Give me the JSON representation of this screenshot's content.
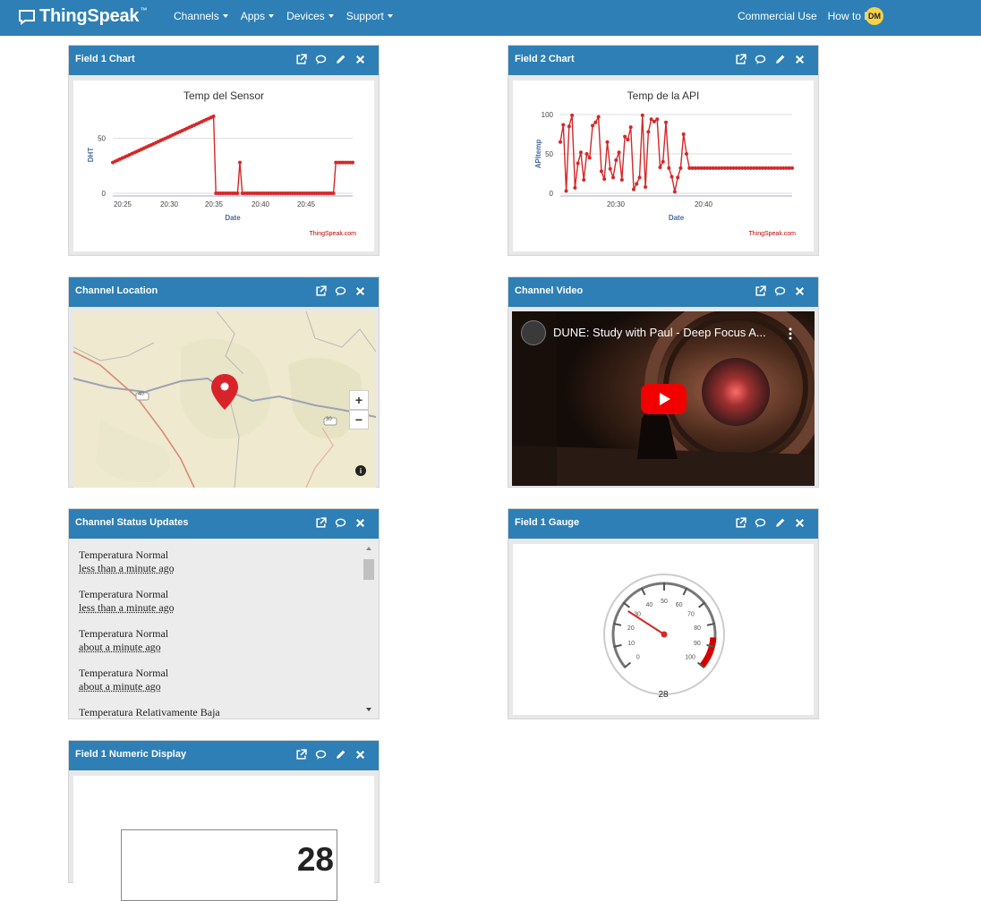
{
  "navbar": {
    "brand": "ThingSpeak",
    "tm": "™",
    "menu": [
      "Channels",
      "Apps",
      "Devices",
      "Support"
    ],
    "commercial_use": "Commercial Use",
    "how_to_buy": "How to Buy",
    "avatar_initials": "DM"
  },
  "widgets": {
    "field1_chart": {
      "title": "Field 1 Chart",
      "chart_title": "Temp del Sensor",
      "watermark": "ThingSpeak.com",
      "chart_data": {
        "type": "line",
        "title": "Temp del Sensor",
        "xlabel": "Date",
        "ylabel": "DHT",
        "x_ticks": [
          "20:25",
          "20:30",
          "20:35",
          "20:40",
          "20:45"
        ],
        "y_ticks": [
          "0",
          "50"
        ],
        "ylim": [
          0,
          70
        ],
        "color": "#d62728",
        "series": [
          {
            "x": [
              0,
              1,
              2,
              3,
              4,
              5,
              6,
              7,
              8,
              9,
              10,
              11,
              12,
              13,
              14,
              15,
              16,
              17,
              18,
              19,
              20,
              21,
              22,
              23,
              24,
              25,
              26,
              27,
              28,
              29,
              30,
              31,
              32,
              33,
              34,
              35,
              36,
              37,
              38,
              39,
              40,
              41,
              42,
              43,
              44,
              45,
              46,
              47,
              48,
              49,
              50,
              51,
              52,
              53,
              54,
              55,
              56,
              57,
              58,
              59,
              60,
              61,
              62,
              63,
              64,
              65,
              66,
              67,
              68,
              69,
              70,
              71,
              72,
              73,
              74,
              75,
              76,
              77,
              78,
              79,
              80,
              81,
              82,
              83,
              84,
              85,
              86,
              87,
              88,
              89,
              90,
              91,
              92,
              93,
              94,
              95,
              96,
              97,
              98,
              99,
              100
            ],
            "y": [
              28,
              29,
              30,
              31,
              32,
              33,
              34,
              35,
              36,
              37,
              38,
              39,
              40,
              41,
              42,
              43,
              44,
              45,
              46,
              47,
              48,
              49,
              50,
              51,
              52,
              53,
              54,
              55,
              56,
              57,
              58,
              59,
              60,
              61,
              62,
              63,
              64,
              65,
              66,
              67,
              68,
              69,
              70,
              0,
              0,
              0,
              0,
              0,
              0,
              0,
              0,
              0,
              0,
              28,
              0,
              0,
              0,
              0,
              0,
              0,
              0,
              0,
              0,
              0,
              0,
              0,
              0,
              0,
              0,
              0,
              0,
              0,
              0,
              0,
              0,
              0,
              0,
              0,
              0,
              0,
              0,
              0,
              0,
              0,
              0,
              0,
              0,
              0,
              0,
              0,
              0,
              0,
              0,
              28,
              28,
              28,
              28,
              28,
              28,
              28,
              28
            ]
          }
        ]
      }
    },
    "field2_chart": {
      "title": "Field 2 Chart",
      "chart_title": "Temp de la API",
      "watermark": "ThingSpeak.com",
      "chart_data": {
        "type": "line",
        "title": "Temp de la API",
        "xlabel": "Date",
        "ylabel": "APItemp",
        "x_ticks": [
          "20:30",
          "20:40"
        ],
        "y_ticks": [
          "0",
          "50",
          "100"
        ],
        "ylim": [
          0,
          100
        ],
        "color": "#d62728",
        "series": [
          {
            "y": [
              65,
              87,
              3,
              85,
              99,
              7,
              38,
              52,
              17,
              50,
              45,
              86,
              90,
              97,
              28,
              18,
              65,
              31,
              20,
              42,
              52,
              17,
              72,
              68,
              84,
              5,
              12,
              20,
              99,
              8,
              78,
              94,
              91,
              94,
              33,
              40,
              90,
              32,
              21,
              2,
              20,
              32,
              75,
              50,
              32,
              32,
              32,
              32,
              32,
              32,
              32,
              32,
              32,
              32,
              32,
              32,
              32,
              32,
              32,
              32,
              32,
              32,
              32,
              32,
              32,
              32,
              32,
              32,
              32,
              32,
              32,
              32,
              32,
              32,
              32,
              32,
              32,
              32,
              32,
              32
            ]
          }
        ]
      }
    },
    "channel_location": {
      "title": "Channel Location",
      "zoom_in": "+",
      "zoom_out": "−",
      "info": "i",
      "road_labels": [
        "40",
        "30"
      ]
    },
    "channel_video": {
      "title": "Channel Video",
      "video_title": "DUNE: Study with Paul - Deep Focus A..."
    },
    "status_updates": {
      "title": "Channel Status Updates",
      "items": [
        {
          "text": "Temperatura Normal",
          "time": "less than a minute ago"
        },
        {
          "text": "Temperatura Normal",
          "time": "less than a minute ago"
        },
        {
          "text": "Temperatura Normal",
          "time": "about a minute ago"
        },
        {
          "text": "Temperatura Normal",
          "time": "about a minute ago"
        },
        {
          "text": "Temperatura Relativamente Baja",
          "time": ""
        }
      ]
    },
    "field1_gauge": {
      "title": "Field 1 Gauge",
      "value": 28,
      "value_label": "28",
      "ticks": [
        "0",
        "10",
        "20",
        "30",
        "40",
        "50",
        "60",
        "70",
        "80",
        "90",
        "100"
      ]
    },
    "field1_numeric": {
      "title": "Field 1 Numeric Display",
      "value": "28"
    }
  },
  "colors": {
    "nav_bg": "#2d7fb5",
    "accent_red": "#d62728",
    "avatar_bg": "#f6d24a"
  }
}
